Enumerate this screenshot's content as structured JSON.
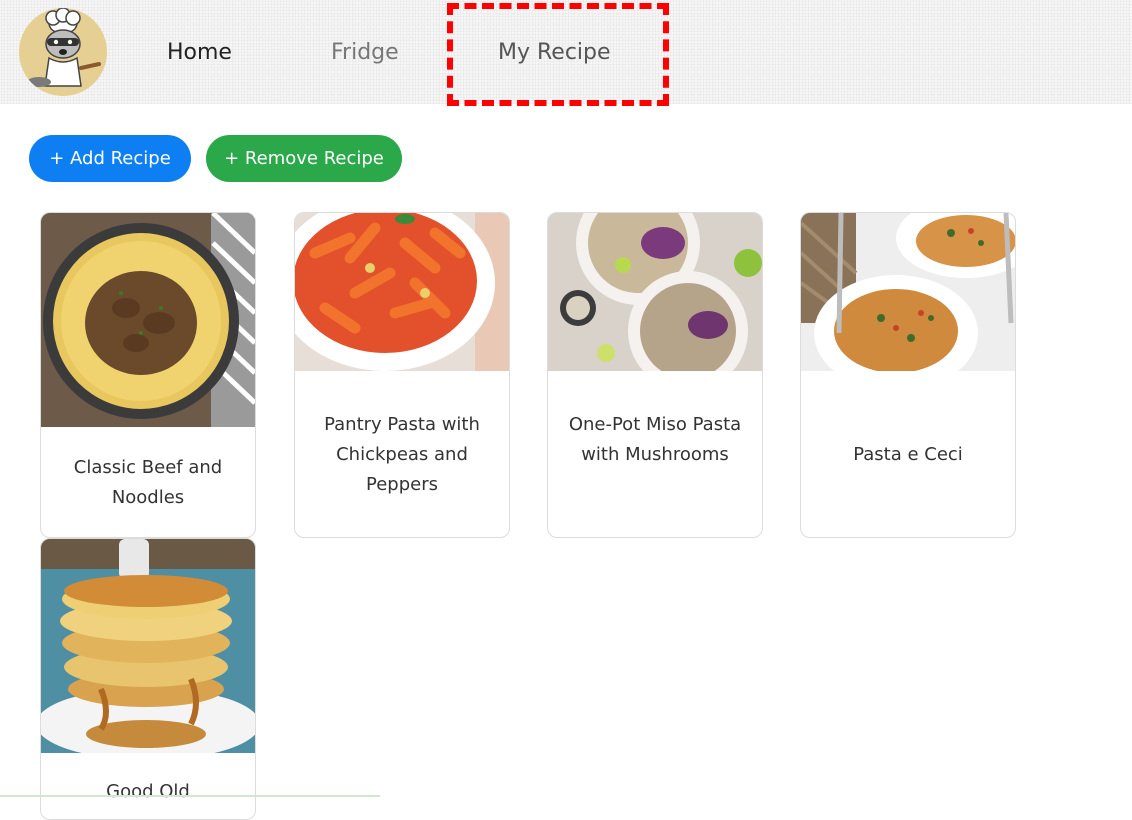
{
  "nav": {
    "home": "Home",
    "fridge": "Fridge",
    "my_recipe": "My Recipe"
  },
  "actions": {
    "add_label": "+ Add Recipe",
    "remove_label": "+ Remove Recipe"
  },
  "colors": {
    "add_button": "#0d7ff2",
    "remove_button": "#2aa84a",
    "highlight": "#ff0000"
  },
  "recipes": [
    {
      "title": "Classic Beef and Noodles",
      "image": "beef-noodles-photo"
    },
    {
      "title": "Pantry Pasta with Chickpeas and Peppers",
      "image": "penne-pasta-photo"
    },
    {
      "title": "One-Pot Miso Pasta with Mushrooms",
      "image": "miso-pasta-photo"
    },
    {
      "title": "Pasta e Ceci",
      "image": "pasta-e-ceci-photo"
    },
    {
      "title": "Good Old",
      "image": "pancakes-photo"
    }
  ]
}
